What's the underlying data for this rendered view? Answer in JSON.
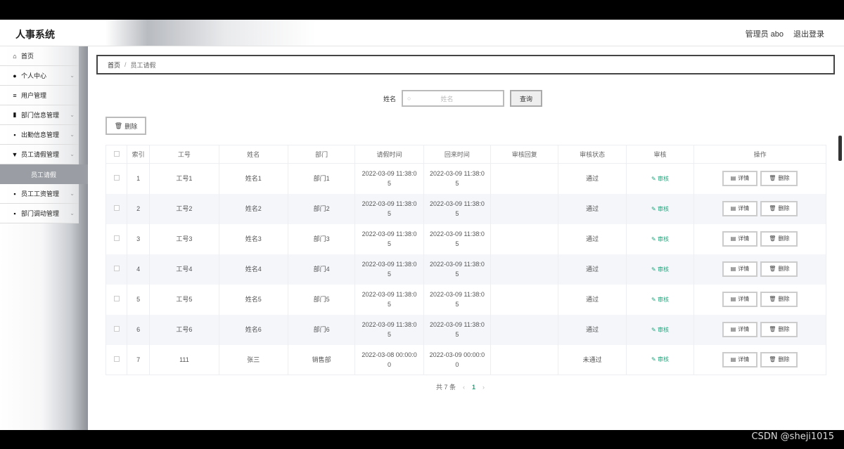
{
  "header": {
    "brand": "人事系统",
    "user": "管理员 abo",
    "logout": "退出登录"
  },
  "sidebar": {
    "items": [
      {
        "label": "首页",
        "icon": "home-icon",
        "glyph": "⌂",
        "chevron": false
      },
      {
        "label": "个人中心",
        "icon": "user-icon",
        "glyph": "●",
        "chevron": true
      },
      {
        "label": "用户管理",
        "icon": "sliders-icon",
        "glyph": "≡",
        "chevron": false
      },
      {
        "label": "部门信息管理",
        "icon": "doc-icon",
        "glyph": "▮",
        "chevron": true
      },
      {
        "label": "出勤信息管理",
        "icon": "grid-icon",
        "glyph": "▪",
        "chevron": true
      },
      {
        "label": "员工请假管理",
        "icon": "cup-icon",
        "glyph": "▼",
        "chevron": true
      },
      {
        "label": "员工工资管理",
        "icon": "grid-icon",
        "glyph": "▪",
        "chevron": true
      },
      {
        "label": "部门调动管理",
        "icon": "grid-icon",
        "glyph": "▪",
        "chevron": true
      }
    ],
    "active_sub": "员工请假"
  },
  "breadcrumb": {
    "home": "首页",
    "sep": "/",
    "current": "员工请假"
  },
  "search": {
    "label": "姓名",
    "placeholder": "姓名",
    "button": "查询"
  },
  "toolbar": {
    "delete": "删除"
  },
  "table": {
    "headers": [
      "索引",
      "工号",
      "姓名",
      "部门",
      "请假时间",
      "回来时间",
      "审核回复",
      "审核状态",
      "审核",
      "操作"
    ],
    "rows": [
      {
        "index": "1",
        "id": "工号1",
        "name": "姓名1",
        "dept": "部门1",
        "leave_l1": "2022-03-09 11:38:0",
        "leave_l2": "5",
        "back_l1": "2022-03-09 11:38:0",
        "back_l2": "5",
        "reply": "",
        "status": "通过"
      },
      {
        "index": "2",
        "id": "工号2",
        "name": "姓名2",
        "dept": "部门2",
        "leave_l1": "2022-03-09 11:38:0",
        "leave_l2": "5",
        "back_l1": "2022-03-09 11:38:0",
        "back_l2": "5",
        "reply": "",
        "status": "通过"
      },
      {
        "index": "3",
        "id": "工号3",
        "name": "姓名3",
        "dept": "部门3",
        "leave_l1": "2022-03-09 11:38:0",
        "leave_l2": "5",
        "back_l1": "2022-03-09 11:38:0",
        "back_l2": "5",
        "reply": "",
        "status": "通过"
      },
      {
        "index": "4",
        "id": "工号4",
        "name": "姓名4",
        "dept": "部门4",
        "leave_l1": "2022-03-09 11:38:0",
        "leave_l2": "5",
        "back_l1": "2022-03-09 11:38:0",
        "back_l2": "5",
        "reply": "",
        "status": "通过"
      },
      {
        "index": "5",
        "id": "工号5",
        "name": "姓名5",
        "dept": "部门5",
        "leave_l1": "2022-03-09 11:38:0",
        "leave_l2": "5",
        "back_l1": "2022-03-09 11:38:0",
        "back_l2": "5",
        "reply": "",
        "status": "通过"
      },
      {
        "index": "6",
        "id": "工号6",
        "name": "姓名6",
        "dept": "部门6",
        "leave_l1": "2022-03-09 11:38:0",
        "leave_l2": "5",
        "back_l1": "2022-03-09 11:38:0",
        "back_l2": "5",
        "reply": "",
        "status": "通过"
      },
      {
        "index": "7",
        "id": "111",
        "name": "张三",
        "dept": "销售部",
        "leave_l1": "2022-03-08 00:00:0",
        "leave_l2": "0",
        "back_l1": "2022-03-09 00:00:0",
        "back_l2": "0",
        "reply": "",
        "status": "未通过"
      }
    ],
    "audit_label": "审核",
    "detail_label": "详情",
    "delete_label": "删除"
  },
  "pager": {
    "total": "共 7 条",
    "prev": "‹",
    "page": "1",
    "next": "›"
  },
  "watermark": "CSDN @sheji1015",
  "colors": {
    "accent": "#1aa57a",
    "active_sub_bg": "#9a9ea4"
  }
}
